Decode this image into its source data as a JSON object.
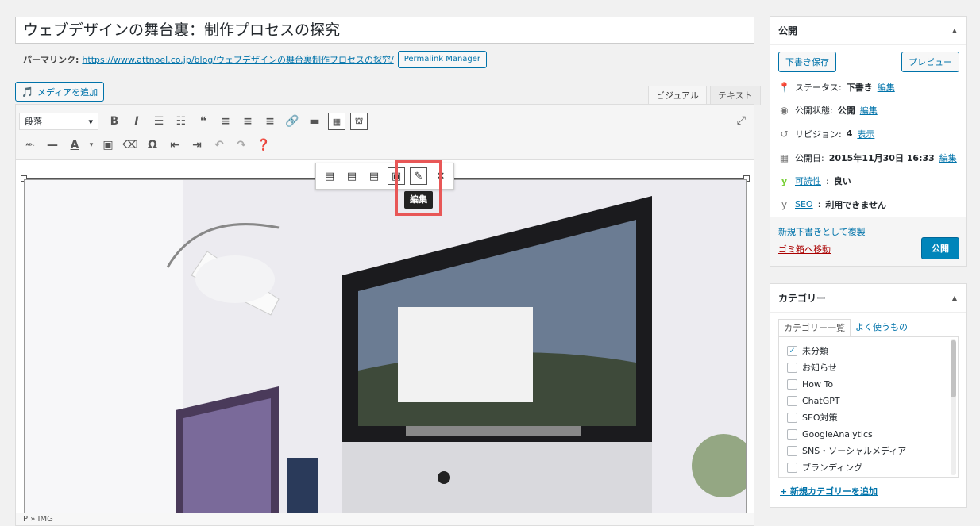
{
  "post": {
    "title": "ウェブデザインの舞台裏：制作プロセスの探究",
    "permalink_label": "パーマリンク:",
    "permalink_url": "https://www.attnoel.co.jp/blog/ウェブデザインの舞台裏制作プロセスの探究/",
    "permalink_manager": "Permalink Manager"
  },
  "editor": {
    "add_media": "メディアを追加",
    "tab_visual": "ビジュアル",
    "tab_text": "テキスト",
    "format_select": "段落",
    "status_path": "P » IMG",
    "edit_tooltip": "編集"
  },
  "publish": {
    "heading": "公開",
    "save_draft": "下書き保存",
    "preview": "プレビュー",
    "status_label": "ステータス:",
    "status_value": "下書き",
    "visibility_label": "公開状態:",
    "visibility_value": "公開",
    "revisions_label": "リビジョン:",
    "revisions_value": "4",
    "show": "表示",
    "date_label": "公開日:",
    "date_value": "2015年11月30日 16:33",
    "edit": "編集",
    "readability_link": "可読性",
    "readability_value": "良い",
    "seo_link": "SEO",
    "seo_value": "利用できません",
    "copy_draft": "新規下書きとして複製",
    "trash": "ゴミ箱へ移動",
    "publish_button": "公開"
  },
  "categories": {
    "heading": "カテゴリー",
    "tab_all": "カテゴリー一覧",
    "tab_popular": "よく使うもの",
    "items": [
      {
        "label": "未分類",
        "checked": true
      },
      {
        "label": "お知らせ",
        "checked": false
      },
      {
        "label": "How To",
        "checked": false
      },
      {
        "label": "ChatGPT",
        "checked": false
      },
      {
        "label": "SEO対策",
        "checked": false
      },
      {
        "label": "GoogleAnalytics",
        "checked": false
      },
      {
        "label": "SNS・ソーシャルメディア",
        "checked": false
      },
      {
        "label": "ブランディング",
        "checked": false
      }
    ],
    "add_new": "+ 新規カテゴリーを追加"
  },
  "colors": {
    "accent": "#0073aa",
    "primary_button": "#0085ba",
    "trash": "#aa0000",
    "highlight": "#e85757"
  }
}
